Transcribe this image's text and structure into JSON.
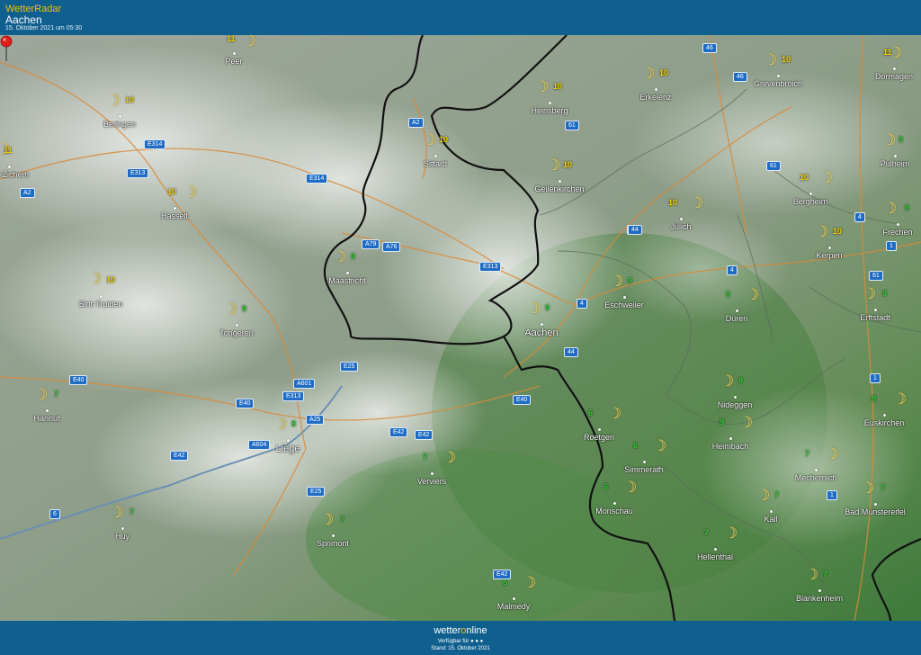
{
  "header": {
    "brand": "WetterRadar",
    "location": "Aachen",
    "timestamp": "15. Oktober 2021 um 05:30"
  },
  "colors": {
    "header_bg": "#0f5f8f",
    "brand": "#f2c200",
    "temp_high": "#f2d200",
    "temp_low": "#36d136",
    "road_sign": "#1f6cc4"
  },
  "icons": {
    "weather": "crescent-moon-icon",
    "selected_location": "red-map-pin-icon"
  },
  "cities": [
    {
      "name": "Peer",
      "temp": "11"
    },
    {
      "name": "Beringen",
      "temp": "10"
    },
    {
      "name": "vel-Zichem",
      "temp": "11"
    },
    {
      "name": "Hasselt",
      "temp": "10"
    },
    {
      "name": "Sint-Truiden",
      "temp": "10"
    },
    {
      "name": "Tongeren",
      "temp": "9"
    },
    {
      "name": "Hannut",
      "temp": "7"
    },
    {
      "name": "Liège",
      "temp": "8"
    },
    {
      "name": "Huy",
      "temp": "7"
    },
    {
      "name": "Sprimont",
      "temp": "7"
    },
    {
      "name": "Verviers",
      "temp": "7"
    },
    {
      "name": "Maastricht",
      "temp": "9"
    },
    {
      "name": "Sittard",
      "temp": "10"
    },
    {
      "name": "Heinsberg",
      "temp": "10"
    },
    {
      "name": "Geilenkirchen",
      "temp": "10"
    },
    {
      "name": "Erkelenz",
      "temp": "10"
    },
    {
      "name": "Grevenbroich",
      "temp": "10"
    },
    {
      "name": "Dormagen",
      "temp": "11"
    },
    {
      "name": "Pulheim",
      "temp": "9"
    },
    {
      "name": "Bergheim",
      "temp": "10"
    },
    {
      "name": "Frechen",
      "temp": "9"
    },
    {
      "name": "Kerpen",
      "temp": "10"
    },
    {
      "name": "Erftstadt",
      "temp": "9"
    },
    {
      "name": "Jülich",
      "temp": "10"
    },
    {
      "name": "Eschweiler",
      "temp": "9"
    },
    {
      "name": "Aachen",
      "temp": "9"
    },
    {
      "name": "Düren",
      "temp": "9"
    },
    {
      "name": "Nideggen",
      "temp": "9"
    },
    {
      "name": "Heimbach",
      "temp": "9"
    },
    {
      "name": "Roetgen",
      "temp": "6"
    },
    {
      "name": "Simmerath",
      "temp": "6"
    },
    {
      "name": "Monschau",
      "temp": "6"
    },
    {
      "name": "Euskirchen",
      "temp": "8"
    },
    {
      "name": "Mechernich",
      "temp": "7"
    },
    {
      "name": "Kall",
      "temp": "7"
    },
    {
      "name": "Bad Münstereifel",
      "temp": "7"
    },
    {
      "name": "Hellenthal",
      "temp": "7"
    },
    {
      "name": "Blankenheim",
      "temp": "7"
    },
    {
      "name": "Malmedy",
      "temp": "6"
    }
  ],
  "roads": [
    "A2",
    "46",
    "61",
    "E314",
    "E313",
    "E314",
    "A2",
    "A79",
    "A76",
    "E313",
    "46",
    "61",
    "44",
    "4",
    "4",
    "61",
    "4",
    "1",
    "44",
    "A601",
    "E25",
    "E40",
    "E313",
    "A25",
    "A604",
    "E40",
    "E42",
    "E42",
    "E42",
    "E25",
    "E40",
    "1",
    "1",
    "E42",
    "6",
    "44"
  ],
  "footer": {
    "brand_prefix": "wetter",
    "brand_o": "o",
    "brand_suffix": "nline",
    "available": "Verfügbar für ● ● ●",
    "status": "Stand: 15. Oktober 2021"
  }
}
